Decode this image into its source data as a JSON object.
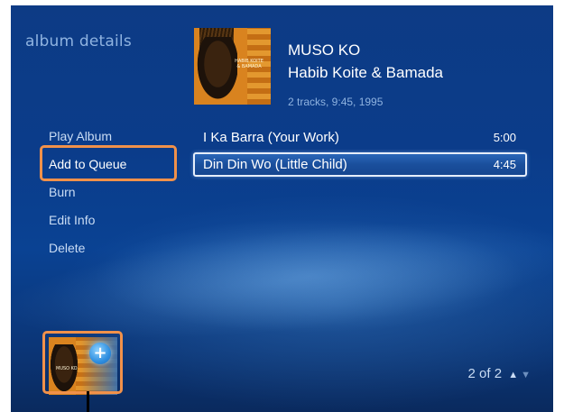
{
  "page": {
    "section_title": "album details"
  },
  "album": {
    "title": "MUSO KO",
    "artist": "Habib Koite & Bamada",
    "meta": "2 tracks, 9:45, 1995",
    "cover_text_line1": "HABIB KOITE",
    "cover_text_line2": "& BAMADA"
  },
  "menu": {
    "items": [
      {
        "label": "Play Album"
      },
      {
        "label": "Add to Queue",
        "highlighted": true
      },
      {
        "label": "Burn"
      },
      {
        "label": "Edit Info"
      },
      {
        "label": "Delete"
      }
    ]
  },
  "tracks": [
    {
      "name": "I Ka Barra (Your Work)",
      "duration": "5:00"
    },
    {
      "name": "Din Din Wo (Little Child)",
      "duration": "4:45",
      "focused": true
    }
  ],
  "pager": {
    "text": "2 of 2",
    "up_icon": "chevron-up-icon",
    "down_icon": "chevron-down-icon"
  },
  "queue": {
    "add_icon": "plus-icon",
    "thumb_label": "MUSO KO"
  },
  "colors": {
    "accent_highlight": "#f1914a",
    "background": "#0b3c8a",
    "secondary_text": "#8fb3e0",
    "focus_border": "#e6eefb"
  }
}
